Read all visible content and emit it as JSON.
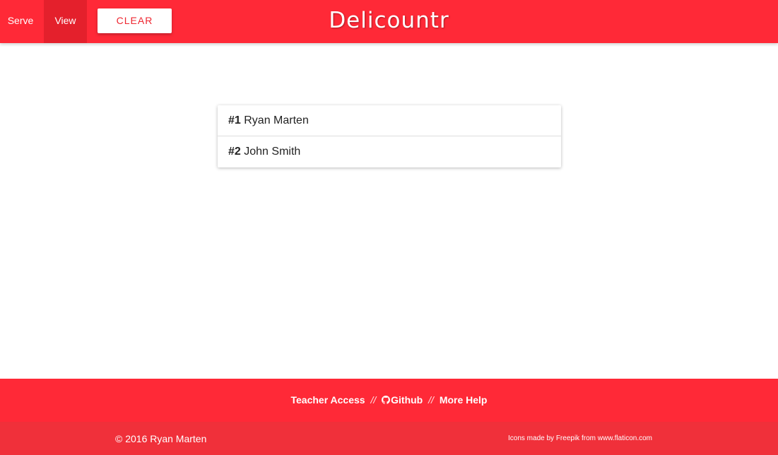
{
  "nav": {
    "tabs": [
      {
        "label": "Serve",
        "active": false
      },
      {
        "label": "View",
        "active": true
      }
    ],
    "clear_label": "CLEAR",
    "brand": "Delicountr",
    "accent_color": "#ff2937",
    "active_tab_color": "#e4202c"
  },
  "queue": {
    "items": [
      {
        "number": "#1",
        "name": "Ryan Marten"
      },
      {
        "number": "#2",
        "name": "John Smith"
      }
    ]
  },
  "footer": {
    "links": {
      "teacher_access": "Teacher Access",
      "github": "Github",
      "more_help": "More Help"
    },
    "separator": "//",
    "github_icon": "github-icon",
    "copyright": "© 2016 Ryan Marten",
    "credits": {
      "prefix": "Icons made by",
      "author": "Freepik",
      "middle": "from",
      "site": "www.flaticon.com"
    },
    "bottom_color": "#f0303a"
  }
}
